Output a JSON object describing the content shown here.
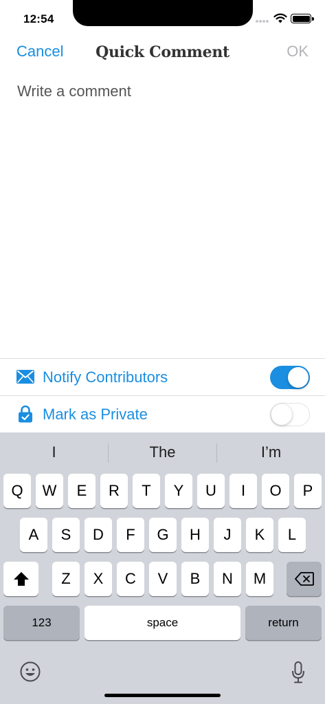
{
  "status_bar": {
    "time": "12:54"
  },
  "nav": {
    "cancel_label": "Cancel",
    "title": "Quick Comment",
    "ok_label": "OK"
  },
  "comment": {
    "placeholder": "Write a comment",
    "value": ""
  },
  "options": [
    {
      "label": "Notify Contributors",
      "icon": "envelope-icon",
      "enabled": true
    },
    {
      "label": "Mark as Private",
      "icon": "lock-icon",
      "enabled": false
    }
  ],
  "keyboard": {
    "suggestions": [
      "I",
      "The",
      "I’m"
    ],
    "row1": [
      "Q",
      "W",
      "E",
      "R",
      "T",
      "Y",
      "U",
      "I",
      "O",
      "P"
    ],
    "row2": [
      "A",
      "S",
      "D",
      "F",
      "G",
      "H",
      "J",
      "K",
      "L"
    ],
    "row3": [
      "Z",
      "X",
      "C",
      "V",
      "B",
      "N",
      "M"
    ],
    "numbers_label": "123",
    "space_label": "space",
    "return_label": "return"
  },
  "colors": {
    "accent": "#1a8ee0",
    "disabled": "#b4b4b8",
    "keyboard_bg": "#d1d4da"
  }
}
